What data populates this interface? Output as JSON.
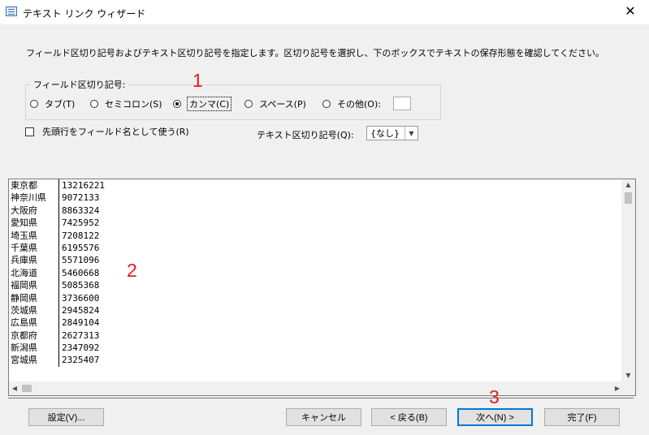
{
  "window": {
    "title": "テキスト リンク ウィザード",
    "close_glyph": "✕"
  },
  "instruction": "フィールド区切り記号およびテキスト区切り記号を指定します。区切り記号を選択し、下のボックスでテキストの保存形態を確認してください。",
  "delimiter_group": {
    "label": "フィールド区切り記号:",
    "options": [
      {
        "label": "タブ(T)",
        "checked": false
      },
      {
        "label": "セミコロン(S)",
        "checked": false
      },
      {
        "label": "カンマ(C)",
        "checked": true
      },
      {
        "label": "スペース(P)",
        "checked": false
      },
      {
        "label": "その他(O):",
        "checked": false
      }
    ],
    "other_value": ""
  },
  "first_row_checkbox": {
    "label": "先頭行をフィールド名として使う(R)",
    "checked": false
  },
  "text_qualifier": {
    "label": "テキスト区切り記号(Q):",
    "value": "{なし}"
  },
  "preview": {
    "rows": [
      [
        "東京都",
        "13216221"
      ],
      [
        "神奈川県",
        "9072133"
      ],
      [
        "大阪府",
        "8863324"
      ],
      [
        "愛知県",
        "7425952"
      ],
      [
        "埼玉県",
        "7208122"
      ],
      [
        "千葉県",
        "6195576"
      ],
      [
        "兵庫県",
        "5571096"
      ],
      [
        "北海道",
        "5460668"
      ],
      [
        "福岡県",
        "5085368"
      ],
      [
        "静岡県",
        "3736600"
      ],
      [
        "茨城県",
        "2945824"
      ],
      [
        "広島県",
        "2849104"
      ],
      [
        "京都府",
        "2627313"
      ],
      [
        "新潟県",
        "2347092"
      ],
      [
        "宮城県",
        "2325407"
      ]
    ]
  },
  "annotations": [
    "1",
    "2",
    "3"
  ],
  "buttons": {
    "settings": "設定(V)...",
    "cancel": "キャンセル",
    "back": "< 戻る(B)",
    "next": "次へ(N) >",
    "finish": "完了(F)"
  }
}
